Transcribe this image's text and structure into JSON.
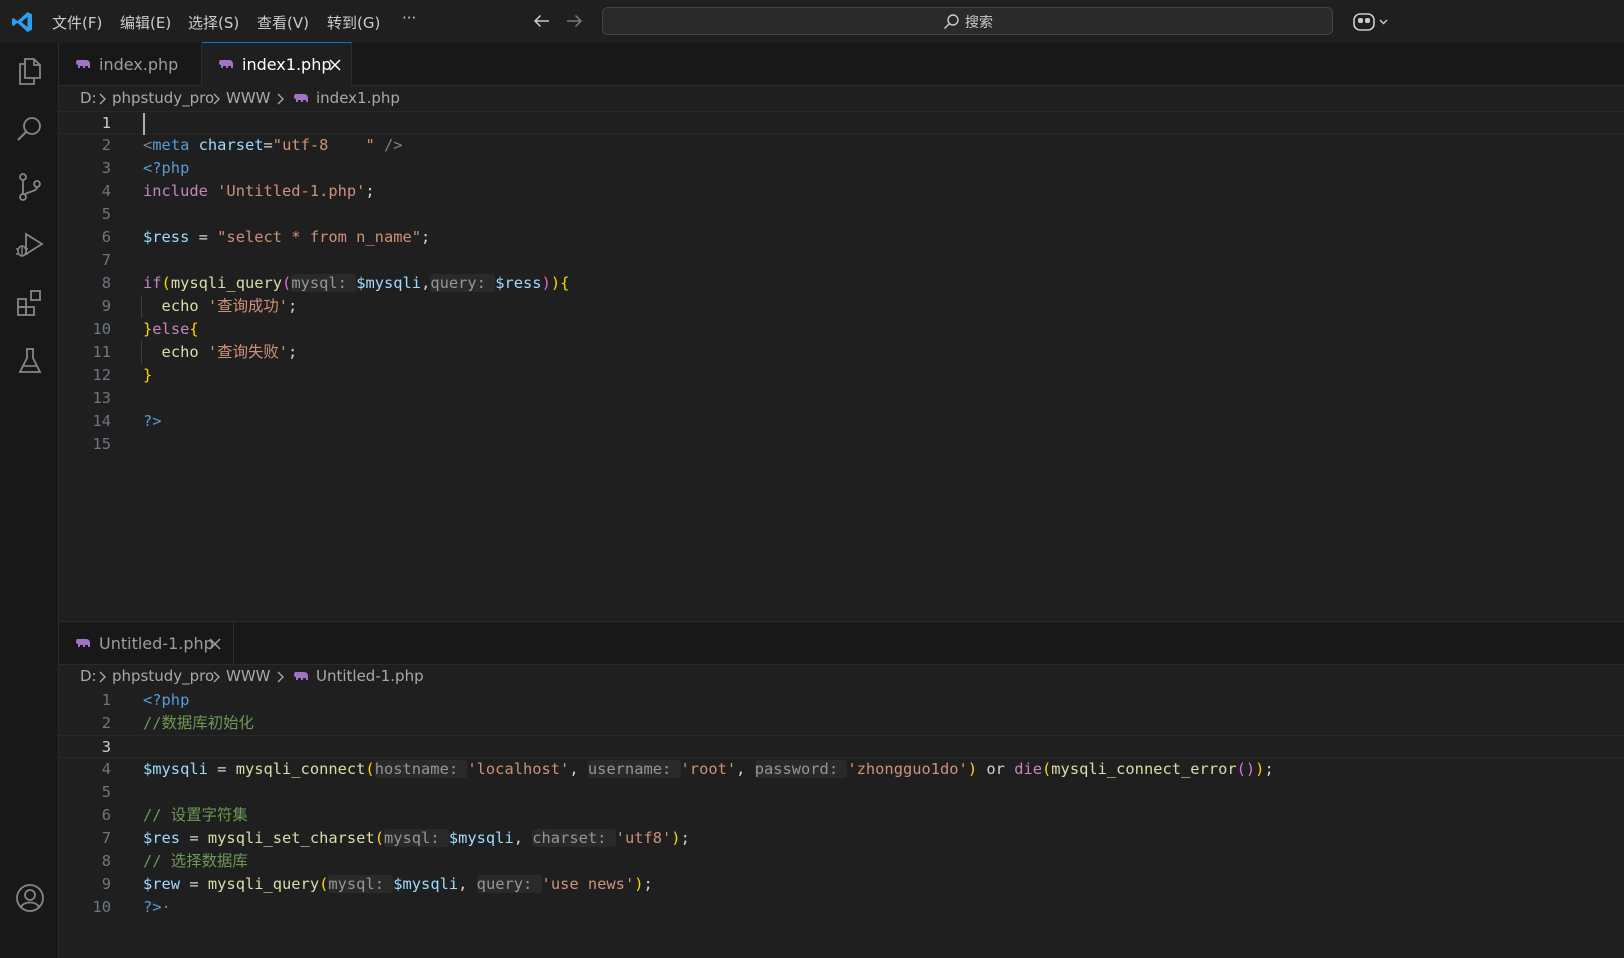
{
  "menu": {
    "items": [
      "文件(F)",
      "编辑(E)",
      "选择(S)",
      "查看(V)",
      "转到(G)",
      "···"
    ]
  },
  "command_center": {
    "label": "搜索"
  },
  "editor_top": {
    "tabs": [
      {
        "label": "index.php",
        "active": false
      },
      {
        "label": "index1.php",
        "active": true
      }
    ],
    "breadcrumb": [
      "D:",
      "phpstudy_pro",
      "WWW",
      "index1.php"
    ],
    "current_line": 1,
    "lines": [
      {
        "n": "1",
        "tokens": []
      },
      {
        "n": "2",
        "tokens": [
          {
            "t": "<",
            "c": "punc"
          },
          {
            "t": "meta",
            "c": "tag"
          },
          {
            "t": " ",
            "c": "op"
          },
          {
            "t": "charset",
            "c": "attr"
          },
          {
            "t": "=",
            "c": "op"
          },
          {
            "t": "\"utf-8    \"",
            "c": "str"
          },
          {
            "t": " />",
            "c": "punc"
          }
        ]
      },
      {
        "n": "3",
        "tokens": [
          {
            "t": "<?php",
            "c": "tag"
          }
        ]
      },
      {
        "n": "4",
        "tokens": [
          {
            "t": "include",
            "c": "kw"
          },
          {
            "t": " ",
            "c": "op"
          },
          {
            "t": "'Untitled-1.php'",
            "c": "str"
          },
          {
            "t": ";",
            "c": "op"
          }
        ]
      },
      {
        "n": "5",
        "tokens": []
      },
      {
        "n": "6",
        "tokens": [
          {
            "t": "$ress",
            "c": "var"
          },
          {
            "t": " = ",
            "c": "op"
          },
          {
            "t": "\"select * from n_name\"",
            "c": "str"
          },
          {
            "t": ";",
            "c": "op"
          }
        ]
      },
      {
        "n": "7",
        "tokens": []
      },
      {
        "n": "8",
        "tokens": [
          {
            "t": "if",
            "c": "kw"
          },
          {
            "t": "(",
            "c": "b1"
          },
          {
            "t": "mysqli_query",
            "c": "fn"
          },
          {
            "t": "(",
            "c": "b2"
          },
          {
            "t": "mysql: ",
            "c": "hint"
          },
          {
            "t": "$mysqli",
            "c": "var"
          },
          {
            "t": ",",
            "c": "op"
          },
          {
            "t": "query: ",
            "c": "hint"
          },
          {
            "t": "$ress",
            "c": "var"
          },
          {
            "t": ")",
            "c": "b2"
          },
          {
            "t": ")",
            "c": "b1"
          },
          {
            "t": "{",
            "c": "b1"
          }
        ]
      },
      {
        "n": "9",
        "tokens": [
          {
            "t": "  ",
            "c": "op"
          },
          {
            "t": "echo",
            "c": "fn"
          },
          {
            "t": " ",
            "c": "op"
          },
          {
            "t": "'查询成功'",
            "c": "str"
          },
          {
            "t": ";",
            "c": "op"
          }
        ]
      },
      {
        "n": "10",
        "tokens": [
          {
            "t": "}",
            "c": "b1"
          },
          {
            "t": "else",
            "c": "kw"
          },
          {
            "t": "{",
            "c": "b1"
          }
        ]
      },
      {
        "n": "11",
        "tokens": [
          {
            "t": "  ",
            "c": "op"
          },
          {
            "t": "echo",
            "c": "fn"
          },
          {
            "t": " ",
            "c": "op"
          },
          {
            "t": "'查询失败'",
            "c": "str"
          },
          {
            "t": ";",
            "c": "op"
          }
        ]
      },
      {
        "n": "12",
        "tokens": [
          {
            "t": "}",
            "c": "b1"
          }
        ]
      },
      {
        "n": "13",
        "tokens": []
      },
      {
        "n": "14",
        "tokens": [
          {
            "t": "?>",
            "c": "tag"
          }
        ]
      },
      {
        "n": "15",
        "tokens": []
      }
    ]
  },
  "editor_bottom": {
    "tabs": [
      {
        "label": "Untitled-1.php",
        "active": false
      }
    ],
    "breadcrumb": [
      "D:",
      "phpstudy_pro",
      "WWW",
      "Untitled-1.php"
    ],
    "current_line": 3,
    "lines": [
      {
        "n": "1",
        "tokens": [
          {
            "t": "<?php",
            "c": "tag"
          }
        ]
      },
      {
        "n": "2",
        "tokens": [
          {
            "t": "//数据库初始化",
            "c": "cmt"
          }
        ]
      },
      {
        "n": "3",
        "tokens": []
      },
      {
        "n": "4",
        "tokens": [
          {
            "t": "$mysqli",
            "c": "var"
          },
          {
            "t": " = ",
            "c": "op"
          },
          {
            "t": "mysqli_connect",
            "c": "fn"
          },
          {
            "t": "(",
            "c": "b1"
          },
          {
            "t": "hostname: ",
            "c": "hint"
          },
          {
            "t": "'localhost'",
            "c": "str"
          },
          {
            "t": ", ",
            "c": "op"
          },
          {
            "t": "username: ",
            "c": "hint"
          },
          {
            "t": "'root'",
            "c": "str"
          },
          {
            "t": ", ",
            "c": "op"
          },
          {
            "t": "password: ",
            "c": "hint"
          },
          {
            "t": "'zhongguo1do'",
            "c": "str"
          },
          {
            "t": ")",
            "c": "b1"
          },
          {
            "t": " or ",
            "c": "op"
          },
          {
            "t": "die",
            "c": "kw"
          },
          {
            "t": "(",
            "c": "b1"
          },
          {
            "t": "mysqli_connect_error",
            "c": "fn"
          },
          {
            "t": "(",
            "c": "b2"
          },
          {
            "t": ")",
            "c": "b2"
          },
          {
            "t": ")",
            "c": "b1"
          },
          {
            "t": ";",
            "c": "op"
          }
        ]
      },
      {
        "n": "5",
        "tokens": []
      },
      {
        "n": "6",
        "tokens": [
          {
            "t": "// 设置字符集",
            "c": "cmt"
          }
        ]
      },
      {
        "n": "7",
        "tokens": [
          {
            "t": "$res",
            "c": "var"
          },
          {
            "t": " = ",
            "c": "op"
          },
          {
            "t": "mysqli_set_charset",
            "c": "fn"
          },
          {
            "t": "(",
            "c": "b1"
          },
          {
            "t": "mysql: ",
            "c": "hint"
          },
          {
            "t": "$mysqli",
            "c": "var"
          },
          {
            "t": ", ",
            "c": "op"
          },
          {
            "t": "charset: ",
            "c": "hint"
          },
          {
            "t": "'utf8'",
            "c": "str"
          },
          {
            "t": ")",
            "c": "b1"
          },
          {
            "t": ";",
            "c": "op"
          }
        ]
      },
      {
        "n": "8",
        "tokens": [
          {
            "t": "// 选择数据库",
            "c": "cmt"
          }
        ]
      },
      {
        "n": "9",
        "tokens": [
          {
            "t": "$rew",
            "c": "var"
          },
          {
            "t": " = ",
            "c": "op"
          },
          {
            "t": "mysqli_query",
            "c": "fn"
          },
          {
            "t": "(",
            "c": "b1"
          },
          {
            "t": "mysql: ",
            "c": "hint"
          },
          {
            "t": "$mysqli",
            "c": "var"
          },
          {
            "t": ", ",
            "c": "op"
          },
          {
            "t": "query: ",
            "c": "hint"
          },
          {
            "t": "'use news'",
            "c": "str"
          },
          {
            "t": ")",
            "c": "b1"
          },
          {
            "t": ";",
            "c": "op"
          }
        ]
      },
      {
        "n": "10",
        "tokens": [
          {
            "t": "?>",
            "c": "tag"
          },
          {
            "t": "·",
            "c": "punc"
          }
        ]
      }
    ]
  },
  "activity_icons": [
    "files-icon",
    "search-icon",
    "source-control-icon",
    "run-debug-icon",
    "extensions-icon",
    "testing-icon",
    "account-icon"
  ],
  "colors": {
    "accent": "#0078d4",
    "editor_bg": "#1f1f1f",
    "sidebar_bg": "#181818",
    "php_icon": "#a074c4"
  }
}
